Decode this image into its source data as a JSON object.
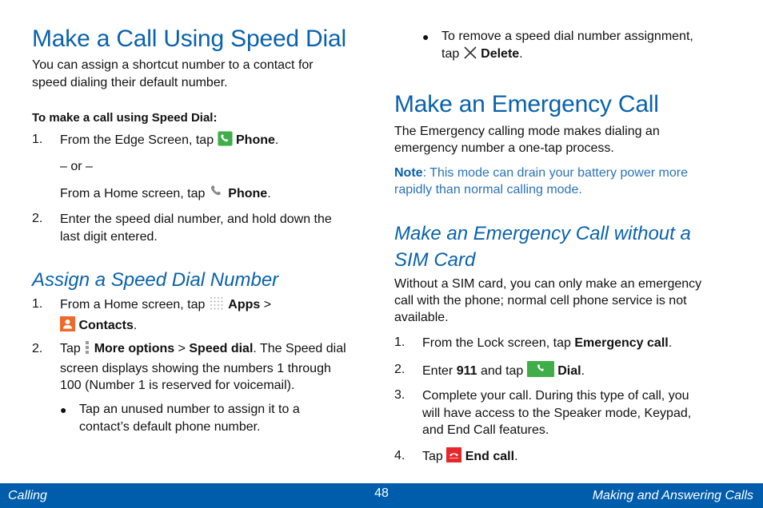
{
  "left": {
    "title": "Make a Call Using Speed Dial",
    "intro": [
      "You can assign a shortcut number to a contact for",
      "speed dialing their default number."
    ],
    "procedure_heading": "To make a call using Speed Dial:",
    "steps": [
      {
        "num": "1.",
        "text_a": "From the Edge Screen, tap ",
        "icon": "edge-phone-icon",
        "bold": "Phone",
        "end": ".",
        "or": "– or –",
        "alt_text": "From a Home screen, tap ",
        "alt_icon": "phone-handset-icon",
        "alt_bold": "Phone",
        "alt_end": "."
      },
      {
        "num": "2.",
        "lines": [
          "Enter the speed dial number, and hold down the",
          "last digit entered."
        ]
      }
    ],
    "subsection_title": "Assign a Speed Dial Number",
    "assign_steps": [
      {
        "num": "1.",
        "text_a": "From a Home screen, tap ",
        "icon1": "apps-grid-icon",
        "bold1": "Apps",
        "sep": " >",
        "icon2": "contacts-icon",
        "bold2": "Contacts",
        "end": "."
      },
      {
        "num": "2.",
        "text_a": "Tap ",
        "icon": "more-options-icon",
        "bold1": "More options",
        "sep": " > ",
        "bold2": "Speed dial",
        "rest": ". The Speed dial",
        "lines": [
          "screen displays showing the numbers 1 through",
          "100 (Number 1 is reserved for voicemail)."
        ]
      }
    ],
    "bullet": [
      "Tap an unused number to assign it to a",
      "contact’s default phone number."
    ]
  },
  "right": {
    "bullet_remove": {
      "line1": "To remove a speed dial number assignment,",
      "text_a": "tap ",
      "icon": "delete-x-icon",
      "bold": "Delete",
      "end": "."
    },
    "title": "Make an Emergency Call",
    "intro": [
      "The Emergency calling mode makes dialing an",
      "emergency number a one-tap process."
    ],
    "note_label": "Note",
    "note_lines": [
      ": This mode can drain your battery power more",
      "rapidly than normal calling mode."
    ],
    "subsection_title": [
      "Make an Emergency Call without a",
      "SIM Card"
    ],
    "sim_intro": [
      "Without a SIM card, you can only make an emergency",
      "call with the phone; normal cell phone service is not",
      "available."
    ],
    "steps": [
      {
        "num": "1.",
        "text_a": "From the Lock screen, tap ",
        "bold": "Emergency call",
        "end": "."
      },
      {
        "num": "2.",
        "text_a": "Enter ",
        "bold1": "911",
        "text_b": " and tap ",
        "icon": "dial-button-icon",
        "bold2": "Dial",
        "end": "."
      },
      {
        "num": "3.",
        "lines": [
          "Complete your call. During this type of call, you",
          "will have access to the Speaker mode, Keypad,",
          "and End Call features."
        ]
      },
      {
        "num": "4.",
        "text_a": "Tap ",
        "icon": "end-call-icon",
        "bold": "End call",
        "end": "."
      }
    ]
  },
  "footer": {
    "left": "Calling",
    "page_number": "48",
    "right": "Making and Answering Calls"
  },
  "colors": {
    "heading_blue": "#0a62ac",
    "note_blue": "#2b73b8",
    "footer_bg": "#005dab",
    "phone_green": "#3fae49",
    "contacts_orange": "#ef6a2a",
    "end_call_red": "#e5262b"
  }
}
